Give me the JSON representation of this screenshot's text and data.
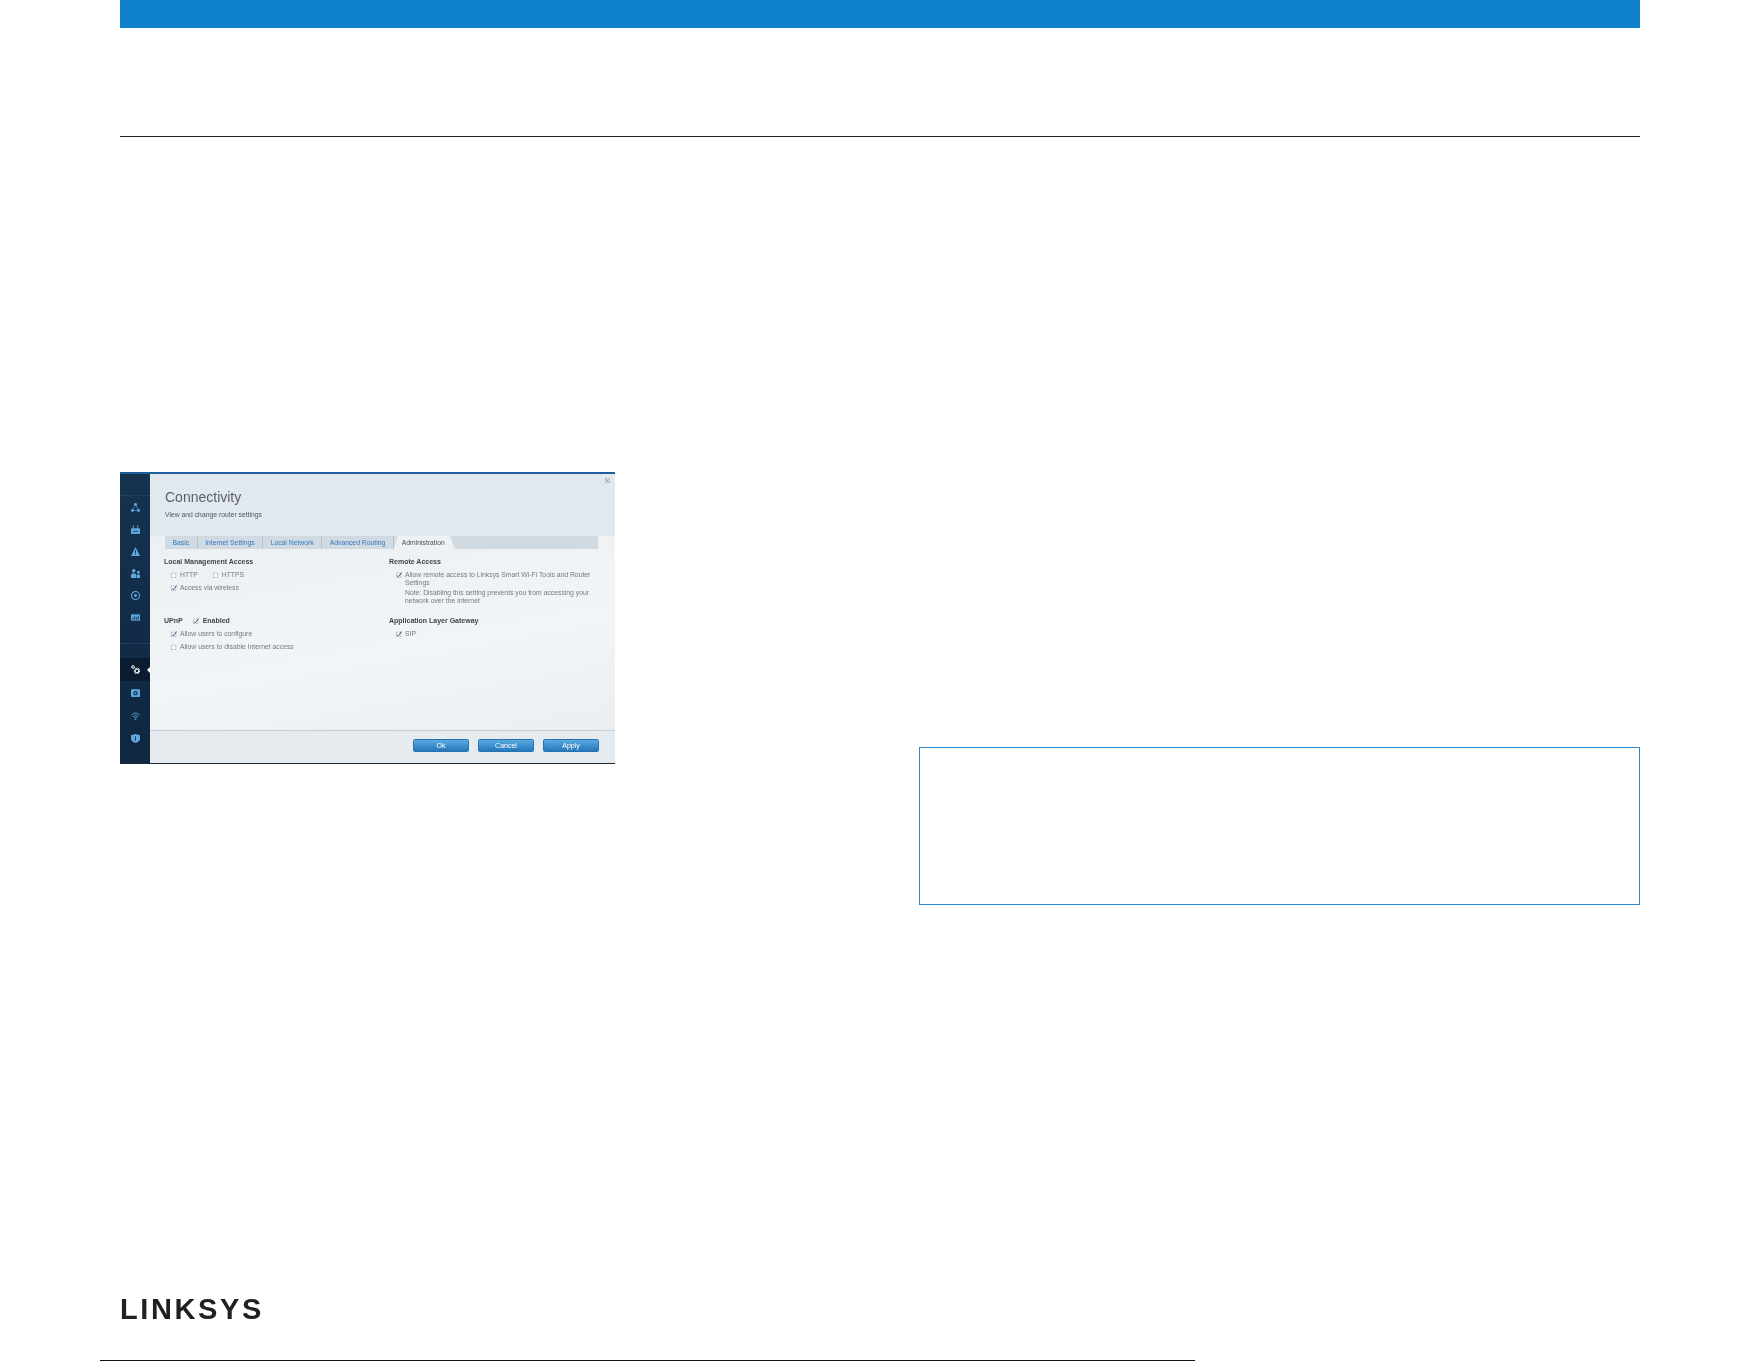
{
  "screenshot": {
    "nav_groups": [
      [
        {
          "selected": false
        },
        {
          "selected": false
        },
        {
          "selected": false
        },
        {
          "selected": false
        },
        {
          "selected": false
        },
        {
          "selected": false
        }
      ],
      [
        {
          "selected": true
        },
        {
          "selected": false
        },
        {
          "selected": false
        },
        {
          "selected": false
        }
      ]
    ],
    "title": "Connectivity",
    "subtitle": "View and change router settings",
    "tabs": [
      {
        "label": "Basic",
        "selected": false
      },
      {
        "label": "Internet Settings",
        "selected": false
      },
      {
        "label": "Local Network",
        "selected": false
      },
      {
        "label": "Advanced Routing",
        "selected": false
      },
      {
        "label": "Administration",
        "selected": true
      }
    ],
    "sections": [
      {
        "heading": "Local Management Access",
        "rows": [
          [
            {
              "label": "HTTP",
              "checked": false
            },
            {
              "label": "HTTPS",
              "checked": false
            }
          ],
          [
            {
              "label": "Access via wireless",
              "checked": true
            }
          ]
        ]
      },
      {
        "heading": "Remote Access",
        "rows": [
          [
            {
              "label": "Allow remote access to Linksys Smart Wi-Fi Tools and Router Settings",
              "checked": true,
              "note": "Note: Disabling this setting prevents you from accessing your network over the internet"
            }
          ]
        ]
      },
      {
        "heading": "UPnP",
        "toggle": {
          "label": "Enabled",
          "checked": true
        },
        "rows": [
          [
            {
              "label": "Allow users to configure",
              "checked": true
            }
          ],
          [
            {
              "label": "Allow users to disable Internet access",
              "checked": false
            }
          ]
        ]
      },
      {
        "heading": "Application Layer Gateway",
        "rows": [
          [
            {
              "label": "SIP",
              "checked": true
            }
          ]
        ]
      }
    ],
    "buttons": [
      "Ok",
      "Cancel",
      "Apply"
    ]
  },
  "logo": "LINKSYS"
}
